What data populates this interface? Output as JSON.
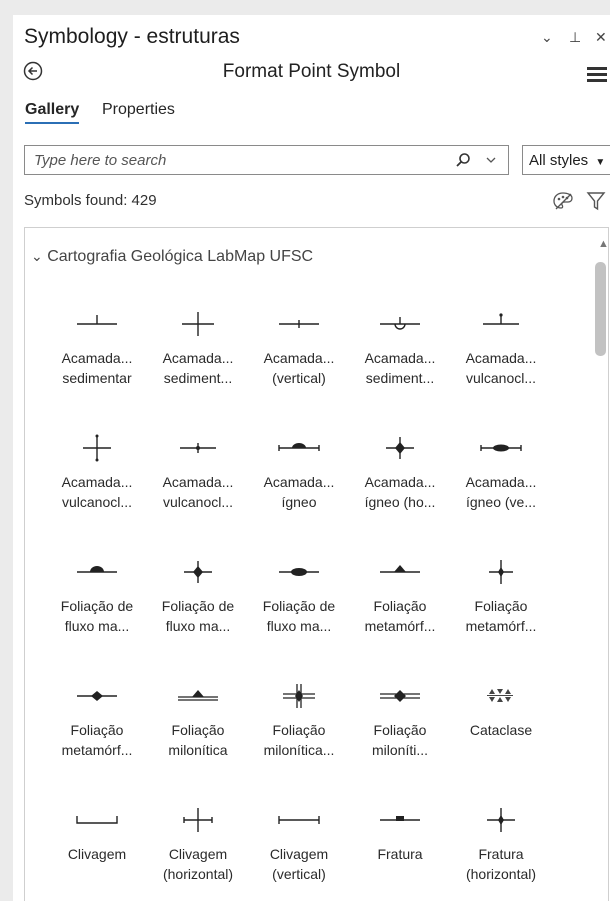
{
  "panel": {
    "title": "Symbology - estruturas",
    "subtitle": "Format Point Symbol",
    "controls": {
      "dropdown": "⌄",
      "pin": "⊥",
      "close": "✕"
    }
  },
  "tabs": [
    {
      "label": "Gallery",
      "active": true
    },
    {
      "label": "Properties",
      "active": false
    }
  ],
  "search": {
    "placeholder": "Type here to search"
  },
  "style_filter": {
    "value": "All styles"
  },
  "symbols_found": "Symbols found: 429",
  "group": {
    "expand_glyph": "⌄",
    "name": "Cartografia Geológica LabMap UFSC"
  },
  "symbols": [
    {
      "l1": "Acamada...",
      "l2": "sedimentar",
      "icon": "bedding-sedimentary-icon"
    },
    {
      "l1": "Acamada...",
      "l2": "sediment...",
      "icon": "bedding-cross-icon"
    },
    {
      "l1": "Acamada...",
      "l2": "(vertical)",
      "icon": "bedding-vertical-icon"
    },
    {
      "l1": "Acamada...",
      "l2": "sediment...",
      "icon": "bedding-overturned-icon"
    },
    {
      "l1": "Acamada...",
      "l2": "vulcanocl...",
      "icon": "bedding-volcaniclastic-icon"
    },
    {
      "l1": "Acamada...",
      "l2": "vulcanocl...",
      "icon": "bedding-volcaniclastic-horizontal-icon"
    },
    {
      "l1": "Acamada...",
      "l2": "vulcanocl...",
      "icon": "bedding-volcaniclastic-vertical-icon"
    },
    {
      "l1": "Acamada...",
      "l2": "ígneo",
      "icon": "bedding-igneous-icon"
    },
    {
      "l1": "Acamada...",
      "l2": "ígneo (ho...",
      "icon": "bedding-igneous-horizontal-icon"
    },
    {
      "l1": "Acamada...",
      "l2": "ígneo (ve...",
      "icon": "bedding-igneous-vertical-icon"
    },
    {
      "l1": "Foliação de",
      "l2": "fluxo ma...",
      "icon": "flow-foliation-icon"
    },
    {
      "l1": "Foliação de",
      "l2": "fluxo ma...",
      "icon": "flow-foliation-horizontal-icon"
    },
    {
      "l1": "Foliação de",
      "l2": "fluxo ma...",
      "icon": "flow-foliation-vertical-icon"
    },
    {
      "l1": "Foliação",
      "l2": "metamórf...",
      "icon": "metamorphic-foliation-icon"
    },
    {
      "l1": "Foliação",
      "l2": "metamórf...",
      "icon": "metamorphic-foliation-horizontal-icon"
    },
    {
      "l1": "Foliação",
      "l2": "metamórf...",
      "icon": "metamorphic-foliation-vertical-icon"
    },
    {
      "l1": "Foliação",
      "l2": "milonítica",
      "icon": "mylonitic-foliation-icon"
    },
    {
      "l1": "Foliação",
      "l2": "milonítica...",
      "icon": "mylonitic-foliation-horizontal-icon"
    },
    {
      "l1": "Foliação",
      "l2": "miloníti...",
      "icon": "mylonitic-foliation-vertical-icon"
    },
    {
      "l1": "Cataclase",
      "l2": "",
      "icon": "cataclasis-icon"
    },
    {
      "l1": "Clivagem",
      "l2": "",
      "icon": "cleavage-icon"
    },
    {
      "l1": "Clivagem",
      "l2": "(horizontal)",
      "icon": "cleavage-horizontal-icon"
    },
    {
      "l1": "Clivagem",
      "l2": "(vertical)",
      "icon": "cleavage-vertical-icon"
    },
    {
      "l1": "Fratura",
      "l2": "",
      "icon": "fracture-icon"
    },
    {
      "l1": "Fratura",
      "l2": "(horizontal)",
      "icon": "fracture-horizontal-icon"
    }
  ]
}
